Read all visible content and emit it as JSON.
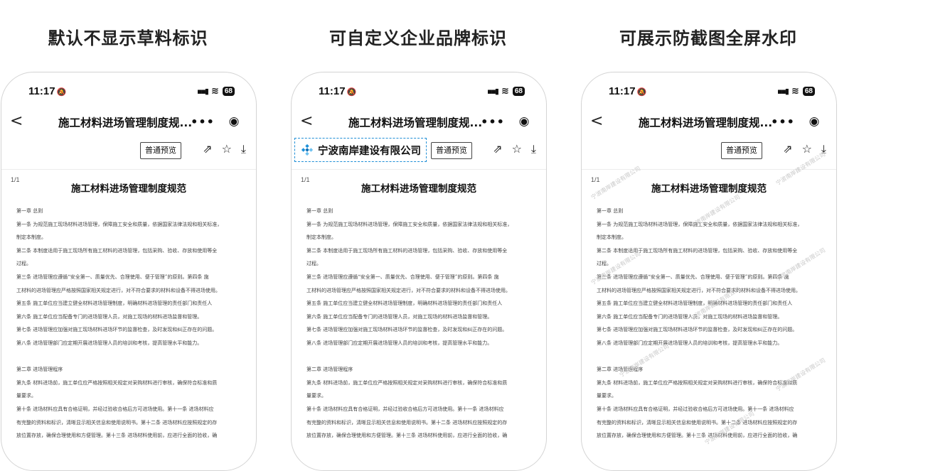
{
  "captions": [
    "默认不显示草料标识",
    "可自定义企业品牌标识",
    "可展示防截图全屏水印"
  ],
  "status": {
    "time": "11:17",
    "battery": "68"
  },
  "nav": {
    "back": "<",
    "title": "施工材料进场管理制度规...",
    "more": "•••",
    "target": "◉"
  },
  "toolbar": {
    "preview": "普通预览",
    "share_icon": "share-icon",
    "star_icon": "star-icon",
    "download_icon": "download-icon"
  },
  "brand": {
    "name": "宁波南岸建设有限公司"
  },
  "watermark": "宁波南岸建设有限公司",
  "doc": {
    "page": "1/1",
    "title": "施工材料进场管理制度规范",
    "lines": [
      "第一章  总则",
      "第一条  为规范施工现场材料进场管理，保障施工安全和质量，依据国家法律法规和相关标准，",
      "制定本制度。",
      "第二条  本制度适用于施工现场所有施工材料的进场管理，包括采购、验收、存放和使用等全",
      "过程。",
      "第三条  进场管理应遵循“安全第一、质量优先、合理使用、便于管理”的原则。第四条  施",
      "工材料的进场管理应严格按照国家相关规定进行，对不符合要求的材料和设备不得进场使用。",
      "第五条  施工单位应当建立健全材料进场管理制度，明确材料进场管理的责任部门和责任人",
      "第六条  施工单位应当配备专门的进场管理人员，对施工现场的材料进场监督和管理。",
      "第七条  进场管理应加强对施工现场材料进场环节的监督检查，及时发现和纠正存在的问题。",
      "第八条  进场管理部门应定期开展进场管理人员的培训和考核，提高管理水平和能力。",
      "",
      "第二章  进场管理程序",
      "第九条  材料进场前，施工单位应严格按照相关规定对采购材料进行审核，确保符合标准和质",
      "量要求。",
      "第十条  进场材料应具有合格证明，并经过验收合格后方可进场使用。第十一条  进场材料应",
      "有完整的资料和标识，清晰显示相关信息和使用说明书。第十二条  进场材料应按照规定的存",
      "放位置存放，确保合理使用和方便管理。第十三条  进场材料使用前，应进行全面的验收，确"
    ]
  }
}
